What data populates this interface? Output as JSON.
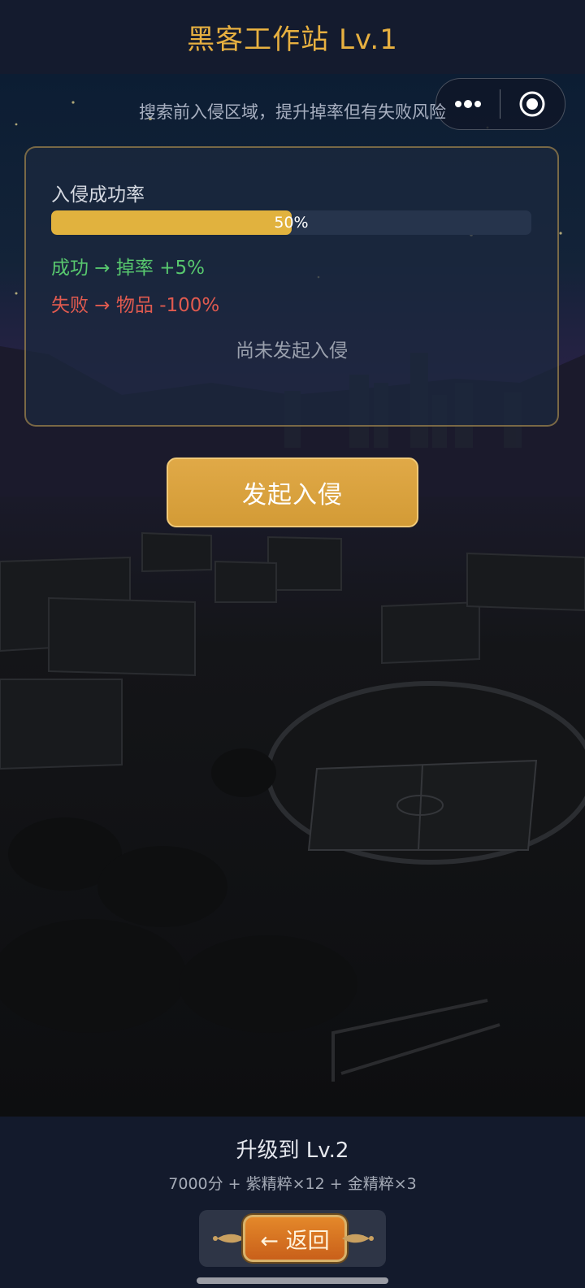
{
  "header": {
    "title": "黑客工作站  Lv.1"
  },
  "capsule": {
    "more_icon": "more-dots-icon",
    "close_icon": "record-target-icon"
  },
  "subtitle": "搜索前入侵区域，提升掉率但有失败风险",
  "card": {
    "label": "入侵成功率",
    "progress": {
      "percent": 50,
      "text": "50%"
    },
    "success_text": "成功 → 掉率 +5%",
    "fail_text": "失败 → 物品 -100%",
    "status": "尚未发起入侵"
  },
  "actions": {
    "attack_label": "发起入侵"
  },
  "footer": {
    "upgrade_title": "升级到 Lv.2",
    "upgrade_cost": "7000分 + 紫精粹×12 + 金精粹×3",
    "back_label": "← 返回"
  },
  "colors": {
    "accent": "#e7b040",
    "success": "#58c86e",
    "fail": "#e05a4f",
    "progress_fill": "#e1b23e"
  }
}
